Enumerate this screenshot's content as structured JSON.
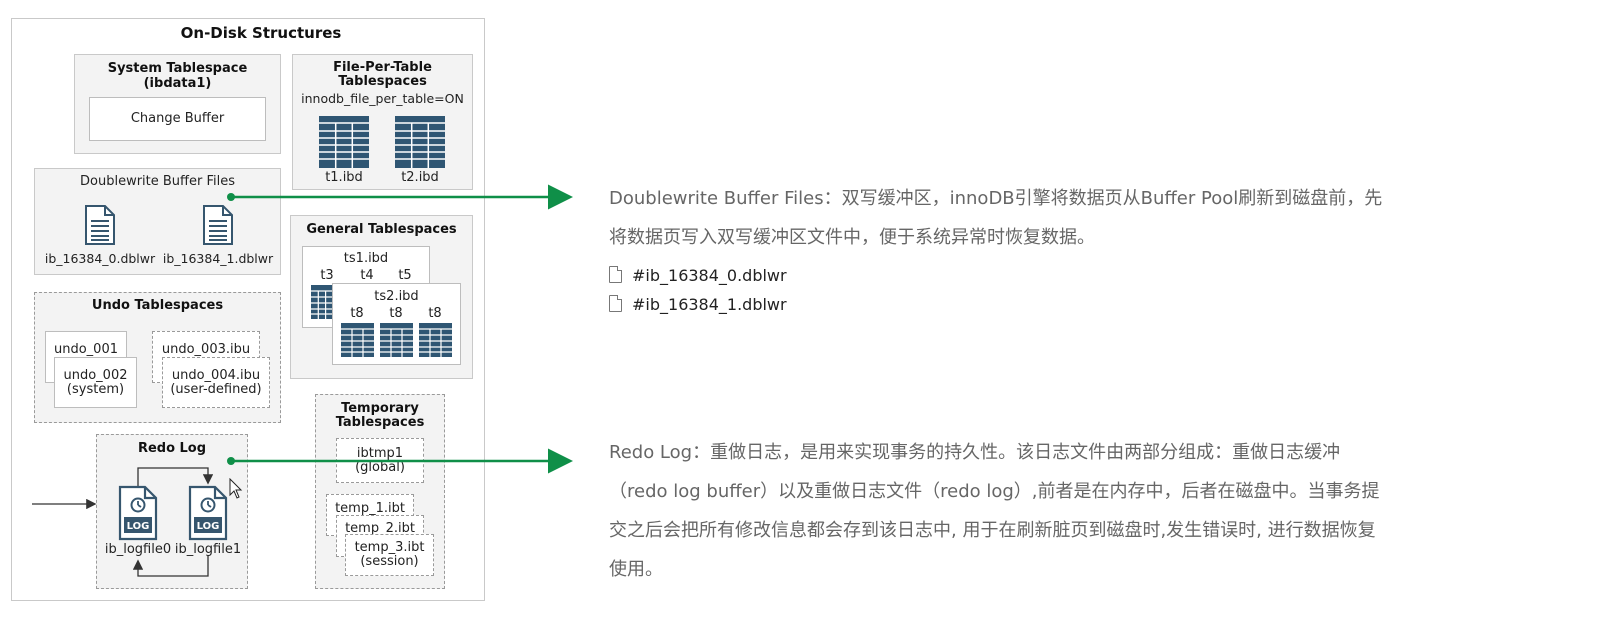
{
  "diagram": {
    "title": "On-Disk Structures",
    "system_tablespace": {
      "title_line1": "System Tablespace",
      "title_line2": "(ibdata1)",
      "change_buffer": "Change Buffer"
    },
    "file_per_table": {
      "title_line1": "File-Per-Table",
      "title_line2": "Tablespaces",
      "setting": "innodb_file_per_table=ON",
      "files": [
        "t1.ibd",
        "t2.ibd"
      ]
    },
    "doublewrite": {
      "title": "Doublewrite Buffer Files",
      "files": [
        "ib_16384_0.dblwr",
        "ib_16384_1.dblwr"
      ]
    },
    "general_tablespaces": {
      "title": "General Tablespaces",
      "ts1": "ts1.ibd",
      "ts1_tables": [
        "t3",
        "t4",
        "t5"
      ],
      "ts2": "ts2.ibd",
      "ts2_tables": [
        "t8",
        "t8",
        "t8"
      ]
    },
    "undo_tablespaces": {
      "title": "Undo Tablespaces",
      "undo_001": "undo_001",
      "undo_002_line1": "undo_002",
      "undo_002_line2": "(system)",
      "undo_003": "undo_003.ibu",
      "undo_004_line1": "undo_004.ibu",
      "undo_004_line2": "(user-defined)"
    },
    "temporary_tablespaces": {
      "title_line1": "Temporary",
      "title_line2": "Tablespaces",
      "ibtmp1_line1": "ibtmp1",
      "ibtmp1_line2": "(global)",
      "temp1": "temp_1.ibt",
      "temp2": "temp_2.ibt",
      "temp3_line1": "temp_3.ibt",
      "temp3_line2": "(session)"
    },
    "redo_log": {
      "title": "Redo Log",
      "files": [
        "ib_logfile0",
        "ib_logfile1"
      ],
      "icon_label": "LOG"
    }
  },
  "annotations": {
    "doublewrite": {
      "line1": "Doublewrite Buffer Files：双写缓冲区，innoDB引擎将数据页从Buffer Pool刷新到磁盘前，先",
      "line2": "将数据页写入双写缓冲区文件中，便于系统异常时恢复数据。",
      "files": [
        "#ib_16384_0.dblwr",
        "#ib_16384_1.dblwr"
      ]
    },
    "redo_log": {
      "line1": "Redo Log：重做日志，是用来实现事务的持久性。该日志文件由两部分组成：重做日志缓冲",
      "line2": "（redo log buffer）以及重做日志文件（redo log）,前者是在内存中，后者在磁盘中。当事务提",
      "line3": "交之后会把所有修改信息都会存到该日志中, 用于在刷新脏页到磁盘时,发生错误时, 进行数据恢复",
      "line4": "使用。"
    }
  },
  "colors": {
    "arrow": "#0f8f48",
    "table_icon": "#2f5673",
    "doc_icon": "#36566e",
    "desc_text": "#666666"
  }
}
